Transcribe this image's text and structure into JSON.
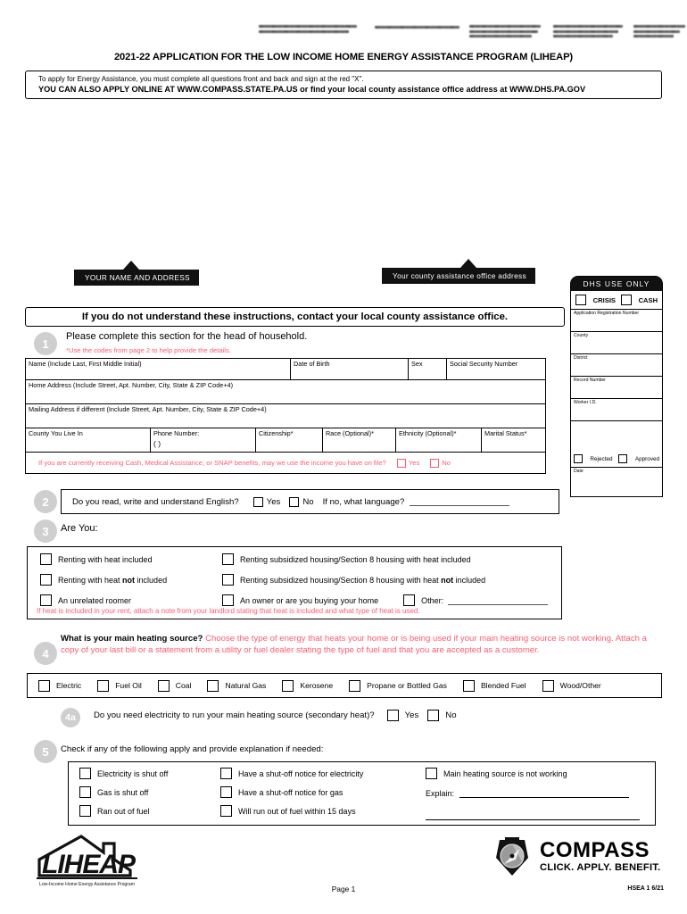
{
  "header": {
    "agency_lines_illegible": true,
    "title": "2021-22 APPLICATION FOR THE LOW INCOME HOME ENERGY ASSISTANCE PROGRAM (LIHEAP)"
  },
  "apply_banner": {
    "line1": "To apply for Energy Assistance, you must complete all questions front and back and sign at the red \"X\".",
    "line2": "YOU CAN ALSO APPLY ONLINE AT WWW.COMPASS.STATE.PA.US or find your local county assistance office address at WWW.DHS.PA.GOV"
  },
  "callouts": {
    "name_address": "YOUR NAME AND ADDRESS",
    "county_office": "Your county assistance office address"
  },
  "dhs_box": {
    "title": "DHS USE ONLY",
    "crisis_label": "CRISIS",
    "cash_label": "CASH",
    "fields": [
      "Application Registration Number",
      "County",
      "District",
      "Record Number",
      "Worker I.D."
    ],
    "rejected_label": "Rejected",
    "approved_label": "Approved",
    "date_label": "Date"
  },
  "understand_banner": "If you do not understand these instructions, contact your local county assistance office.",
  "section1": {
    "number": "1",
    "heading": "Please complete this section for the head of household.",
    "hint": "*Use the codes from page 2 to help provide the details.",
    "row1": [
      "Name (Include Last, First Middle Initial)",
      "Date of Birth",
      "Sex",
      "Social Security Number"
    ],
    "row2": "Home Address (Include Street, Apt. Number, City, State & ZIP Code+4)",
    "row3": "Mailing Address if different (Include Street, Apt. Number, City, State & ZIP Code+4)",
    "row4": [
      "County You Live In",
      "Phone Number:",
      "Citizenship*",
      "Race (Optional)*",
      "Ethnicity (Optional)*",
      "Marital Status*"
    ],
    "phone_mask": "(          )",
    "income_question": "If you are currently receiving Cash, Medical Assistance, or SNAP benefits, may we use the income you have on file?",
    "yes_label": "Yes",
    "no_label": "No"
  },
  "section2": {
    "number": "2",
    "question": "Do you read, write and understand English?",
    "yes_label": "Yes",
    "no_label": "No",
    "followup": "If no, what language?"
  },
  "section3": {
    "number": "3",
    "heading": "Are You:",
    "options_left": [
      {
        "text_before": "Renting with heat included",
        "bold": "",
        "text_after": ""
      },
      {
        "text_before": "Renting with heat ",
        "bold": "not",
        "text_after": " included"
      },
      {
        "text_before": "An unrelated roomer",
        "bold": "",
        "text_after": ""
      }
    ],
    "options_right": [
      {
        "text_before": "Renting subsidized housing/Section 8 housing with heat included",
        "bold": "",
        "text_after": ""
      },
      {
        "text_before": "Renting subsidized housing/Section 8 housing with heat ",
        "bold": "not",
        "text_after": " included"
      },
      {
        "text_before": "An owner or are you buying your home",
        "bold": "",
        "text_after": ""
      }
    ],
    "other_label": "Other:",
    "note": "If heat is included in your rent, attach a note from your landlord stating that heat is included and what type of heat is used."
  },
  "section4": {
    "number": "4",
    "question": "What is your main heating source?",
    "instruction": "Choose the type of energy that heats your home or is being used if your main heating source is not working. Attach a copy of your last bill or a statement from a utility or fuel dealer stating the type of fuel and that you are accepted as a customer.",
    "fuels": [
      "Electric",
      "Fuel Oil",
      "Coal",
      "Natural Gas",
      "Kerosene",
      "Propane or Bottled Gas",
      "Blended Fuel",
      "Wood/Other"
    ]
  },
  "section4a": {
    "number": "4a",
    "question": "Do you need electricity to run your main heating source (secondary heat)?",
    "yes_label": "Yes",
    "no_label": "No"
  },
  "section5": {
    "number": "5",
    "heading": "Check if any of the following apply and provide explanation if needed:",
    "col1": [
      "Electricity is shut off",
      "Gas is shut off",
      "Ran out of fuel"
    ],
    "col2": [
      "Have a shut-off notice for electricity",
      "Have a shut-off notice for gas",
      "Will run out of fuel within 15 days"
    ],
    "col3": [
      "Main heating source is not working"
    ],
    "explain_label": "Explain:"
  },
  "logos": {
    "liheap_word": "LIHEAP",
    "liheap_tagline": "Low-Income Home Energy Assistance Program",
    "compass_word": "COMPASS",
    "compass_tagline": "CLICK. APPLY. BENEFIT."
  },
  "footer": {
    "page": "Page 1",
    "form_code": "HSEA 1  6/21"
  },
  "colors": {
    "red_text": "#ff5a73",
    "step_circle": "#cfcfcf",
    "ink": "#000000"
  }
}
